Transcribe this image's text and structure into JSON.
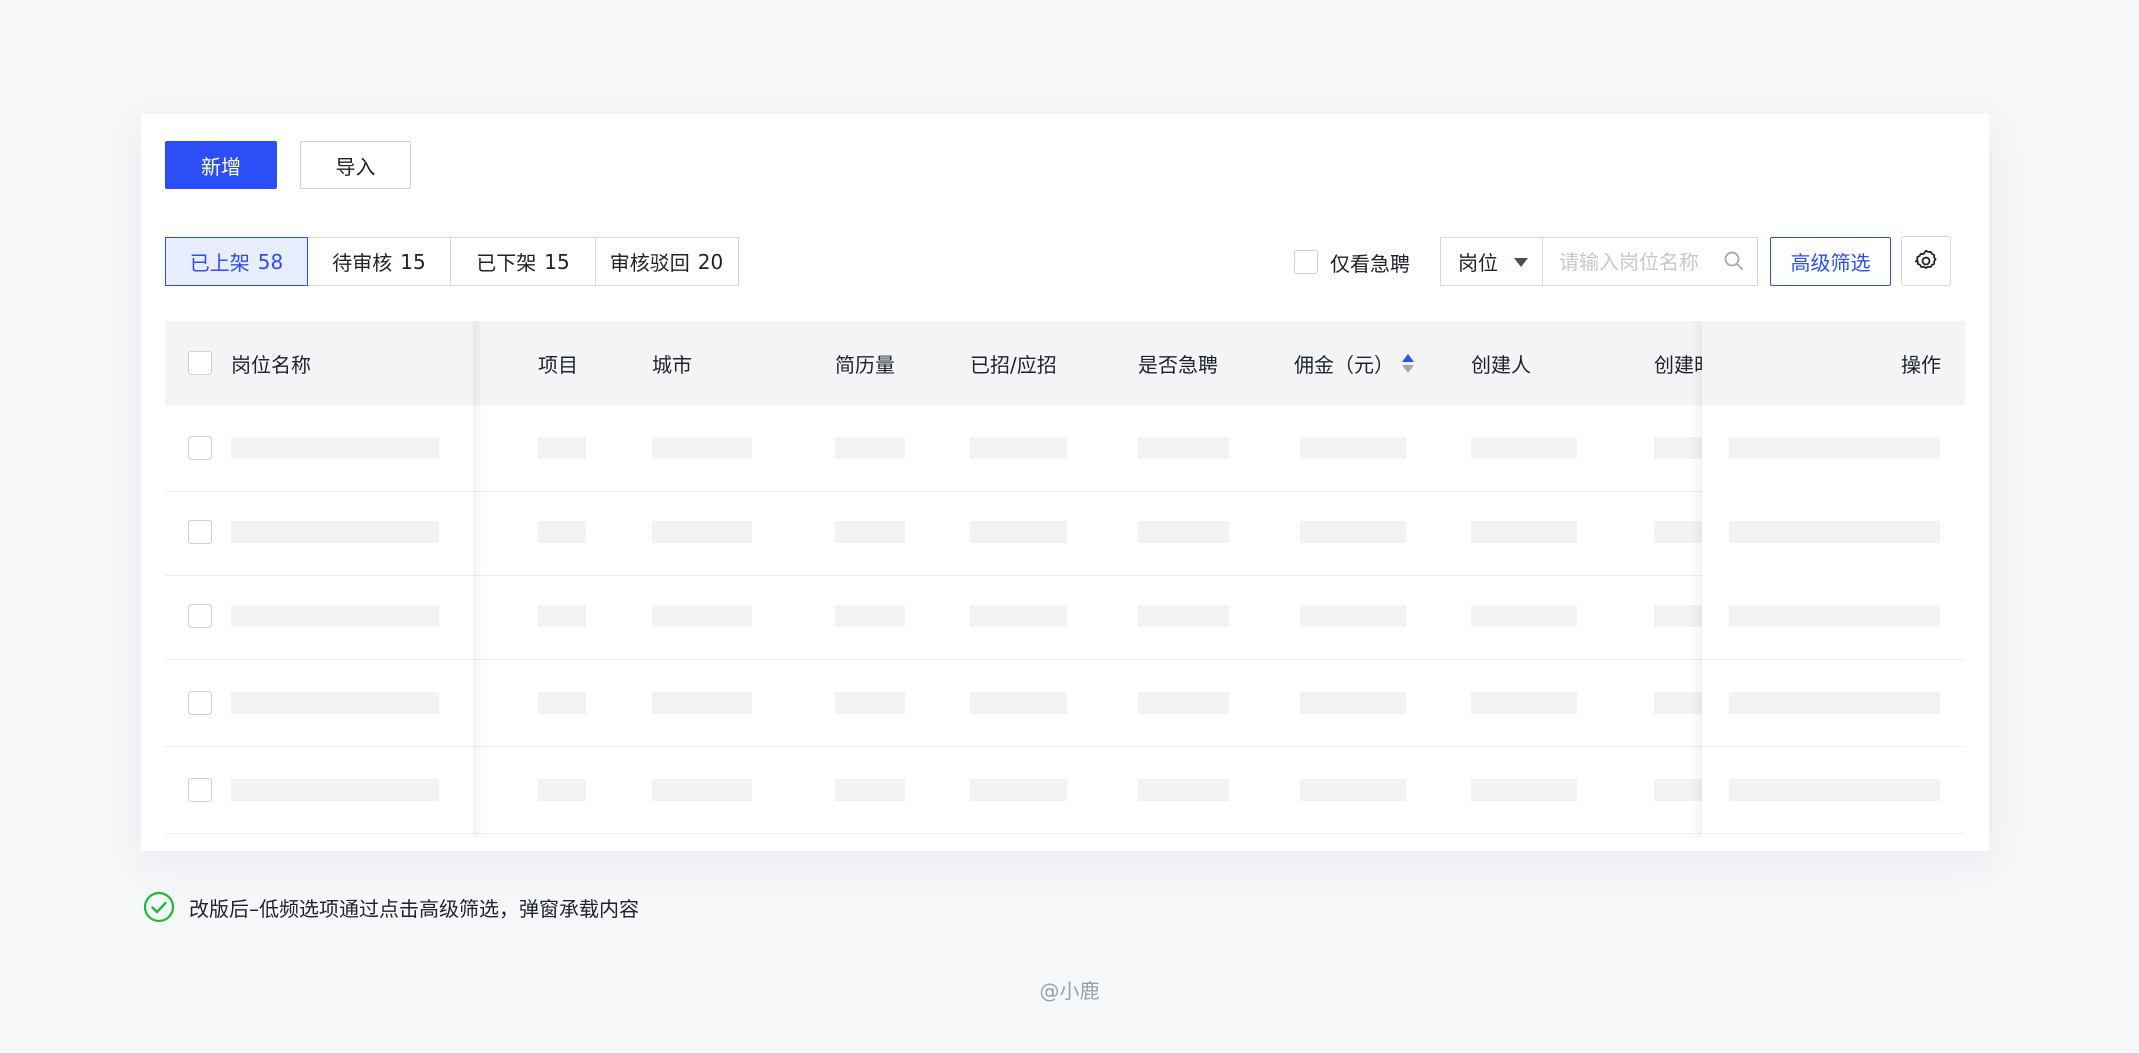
{
  "toolbar": {
    "add_label": "新增",
    "import_label": "导入"
  },
  "status_tabs": [
    {
      "label": "已上架",
      "count": "58",
      "active": true
    },
    {
      "label": "待审核",
      "count": "15",
      "active": false
    },
    {
      "label": "已下架",
      "count": "15",
      "active": false
    },
    {
      "label": "审核驳回",
      "count": "20",
      "active": false
    }
  ],
  "filters": {
    "urgent_only_label": "仅看急聘",
    "search_field_selected": "岗位",
    "search_placeholder": "请输入岗位名称",
    "advanced_filter_label": "高级筛选"
  },
  "table": {
    "columns": [
      "岗位名称",
      "项目",
      "城市",
      "简历量",
      "已招/应招",
      "是否急聘",
      "佣金（元）",
      "创建人",
      "创建时",
      "操作"
    ],
    "sorted_column": "佣金（元）",
    "row_count": 5,
    "loading": true
  },
  "note": "改版后–低频选项通过点击高级筛选，弹窗承载内容",
  "footer": "@小鹿",
  "colors": {
    "primary": "#2b4ef6",
    "success": "#22b83a",
    "background": "#f6f7f9"
  }
}
